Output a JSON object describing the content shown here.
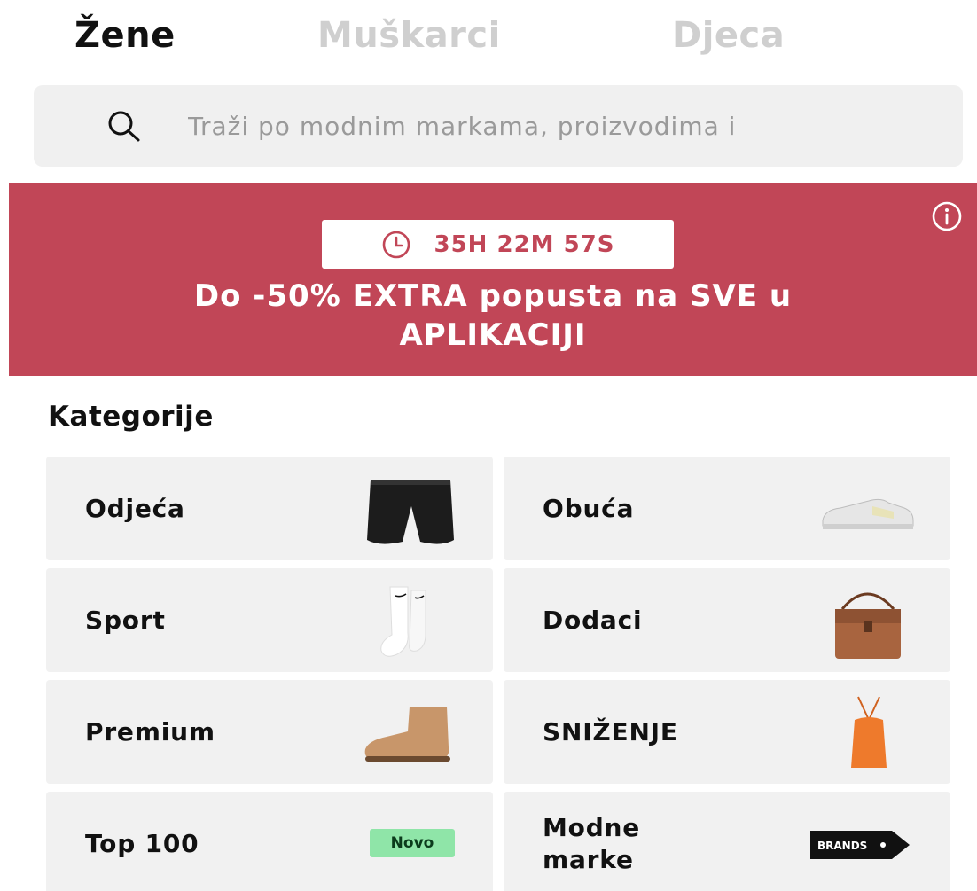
{
  "tabs": [
    {
      "label": "Žene",
      "active": true
    },
    {
      "label": "Muškarci",
      "active": false
    },
    {
      "label": "Djeca",
      "active": false
    }
  ],
  "search": {
    "placeholder": "Traži po modnim markama, proizvodima i",
    "icon": "search-icon"
  },
  "banner": {
    "background": "#c14657",
    "countdown": "35H 22M 57S",
    "headline_line1": "Do -50% EXTRA popusta na SVE u",
    "headline_line2": "APLIKACIJI",
    "info_icon": "info-icon",
    "clock_icon": "clock-icon"
  },
  "categories": {
    "title": "Kategorije",
    "items": [
      {
        "label": "Odjeća",
        "image": "shorts-image"
      },
      {
        "label": "Obuća",
        "image": "sneaker-image"
      },
      {
        "label": "Sport",
        "image": "socks-image"
      },
      {
        "label": "Dodaci",
        "image": "bag-image"
      },
      {
        "label": "Premium",
        "image": "boot-image"
      },
      {
        "label": "SNIŽENJE",
        "image": "dress-image"
      },
      {
        "label": "Top 100",
        "badge": "Novo"
      },
      {
        "label": "Modne marke",
        "image": "brands-tag",
        "brand_tag_text": "BRANDS"
      }
    ]
  }
}
